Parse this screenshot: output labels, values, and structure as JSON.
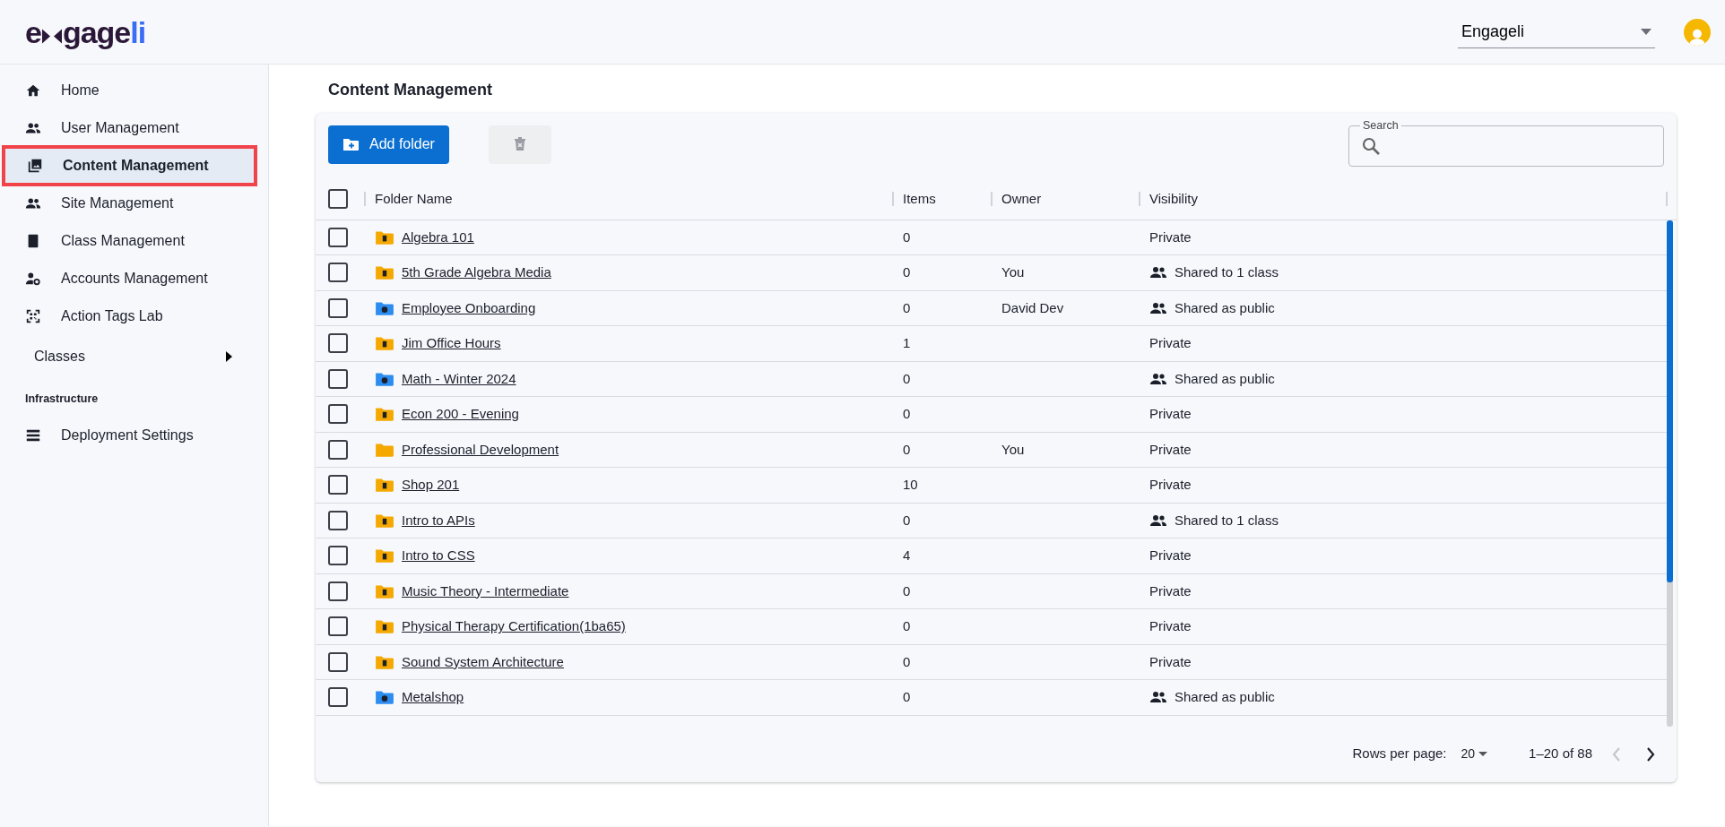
{
  "logo": {
    "lead": "e",
    "body": "gage",
    "accent": "li"
  },
  "org_select": {
    "value": "Engageli"
  },
  "sidebar": {
    "items": [
      {
        "label": "Home",
        "selected": false
      },
      {
        "label": "User Management",
        "selected": false
      },
      {
        "label": "Content Management",
        "selected": true
      },
      {
        "label": "Site Management",
        "selected": false
      },
      {
        "label": "Class Management",
        "selected": false
      },
      {
        "label": "Accounts Management",
        "selected": false
      },
      {
        "label": "Action Tags Lab",
        "selected": false
      }
    ],
    "classes": {
      "label": "Classes",
      "expanded": false
    },
    "section_title": "Infrastructure",
    "section_items": [
      {
        "label": "Deployment Settings",
        "selected": false
      }
    ]
  },
  "page_title": "Content Management",
  "toolbar": {
    "add_button": "Add folder",
    "delete_disabled": true,
    "search": {
      "label": "Search"
    }
  },
  "table": {
    "select_all_checked": false,
    "columns": [
      "Folder Name",
      "Items",
      "Owner",
      "Visibility"
    ],
    "rows": [
      {
        "name": "Algebra 101",
        "kind": "class",
        "items": "0",
        "owner": "",
        "visibility": "Private",
        "shared": false,
        "checked": false
      },
      {
        "name": "5th Grade Algebra Media",
        "kind": "class",
        "items": "0",
        "owner": "You",
        "visibility": "Shared to 1 class",
        "shared": true,
        "checked": false
      },
      {
        "name": "Employee Onboarding",
        "kind": "public",
        "items": "0",
        "owner": "David Dev",
        "visibility": "Shared as public",
        "shared": true,
        "checked": false
      },
      {
        "name": "Jim Office Hours",
        "kind": "class",
        "items": "1",
        "owner": "",
        "visibility": "Private",
        "shared": false,
        "checked": false
      },
      {
        "name": "Math - Winter 2024",
        "kind": "public",
        "items": "0",
        "owner": "",
        "visibility": "Shared as public",
        "shared": true,
        "checked": false
      },
      {
        "name": "Econ 200 - Evening",
        "kind": "class",
        "items": "0",
        "owner": "",
        "visibility": "Private",
        "shared": false,
        "checked": false
      },
      {
        "name": "Professional Development",
        "kind": "plain",
        "items": "0",
        "owner": "You",
        "visibility": "Private",
        "shared": false,
        "checked": false
      },
      {
        "name": "Shop 201",
        "kind": "class",
        "items": "10",
        "owner": "",
        "visibility": "Private",
        "shared": false,
        "checked": false
      },
      {
        "name": "Intro to APIs",
        "kind": "class",
        "items": "0",
        "owner": "",
        "visibility": "Shared to 1 class",
        "shared": true,
        "checked": false
      },
      {
        "name": "Intro to CSS",
        "kind": "class",
        "items": "4",
        "owner": "",
        "visibility": "Private",
        "shared": false,
        "checked": false
      },
      {
        "name": "Music Theory - Intermediate",
        "kind": "class",
        "items": "0",
        "owner": "",
        "visibility": "Private",
        "shared": false,
        "checked": false
      },
      {
        "name": "Physical Therapy Certification(1ba65)",
        "kind": "class",
        "items": "0",
        "owner": "",
        "visibility": "Private",
        "shared": false,
        "checked": false
      },
      {
        "name": "Sound System Architecture",
        "kind": "class",
        "items": "0",
        "owner": "",
        "visibility": "Private",
        "shared": false,
        "checked": false
      },
      {
        "name": "Metalshop",
        "kind": "public",
        "items": "0",
        "owner": "",
        "visibility": "Shared as public",
        "shared": true,
        "checked": false
      }
    ]
  },
  "pagination": {
    "rows_label": "Rows per page:",
    "rows_value": "20",
    "range": "1–20 of 88",
    "prev_disabled": true,
    "next_disabled": false
  }
}
